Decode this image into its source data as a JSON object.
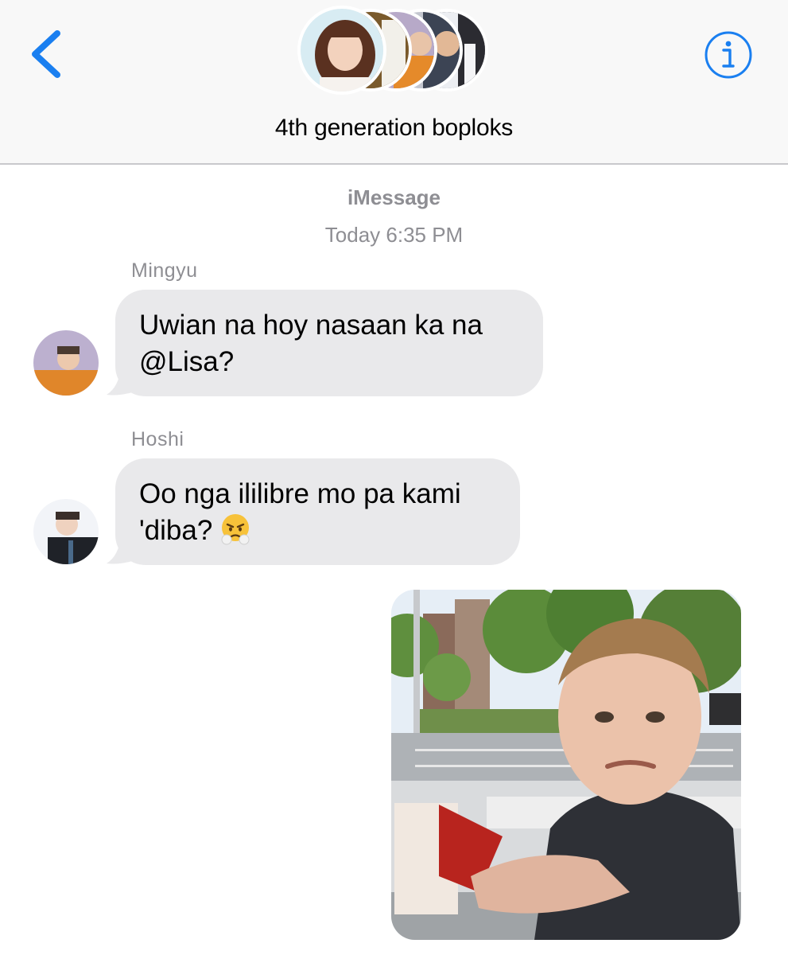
{
  "header": {
    "group_name": "4th generation boploks",
    "back_icon": "chevron-left-icon",
    "info_icon": "info-circle-icon",
    "accent_color": "#1a7ff0"
  },
  "conversation": {
    "service": "iMessage",
    "timestamp": "Today 6:35 PM"
  },
  "messages": [
    {
      "sender": "Mingyu",
      "lines": [
        "Uwian na hoy nasaan ka na",
        "@Lisa?"
      ],
      "direction": "incoming"
    },
    {
      "sender": "Hoshi",
      "lines": [
        "Oo nga ililibre mo pa kami",
        "'diba?"
      ],
      "emoji": "face-with-steam-from-nose",
      "direction": "incoming"
    },
    {
      "type": "image",
      "description_icon": "photo-attachment",
      "direction": "outgoing"
    }
  ],
  "colors": {
    "incoming_bubble": "#e9e9eb",
    "secondary_text": "#8e8e93",
    "header_bg": "#f8f8f8"
  }
}
